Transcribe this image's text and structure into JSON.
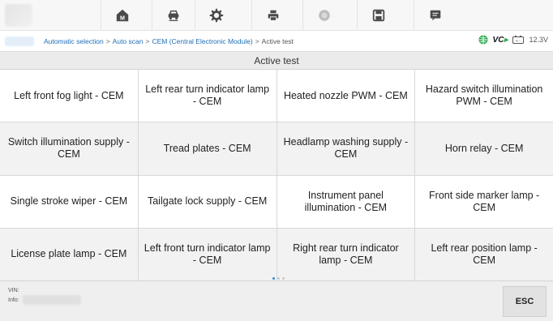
{
  "toolbar": {
    "buttons": [
      {
        "name": "home-icon"
      },
      {
        "name": "vehicle-swap-icon"
      },
      {
        "name": "settings-icon"
      },
      {
        "name": "print-icon"
      },
      {
        "name": "help-icon"
      },
      {
        "name": "save-icon"
      },
      {
        "name": "datalogging-icon"
      }
    ],
    "home_label": "M"
  },
  "breadcrumb": {
    "items": [
      "Automatic selection",
      "Auto scan",
      "CEM (Central Electronic Module)",
      "Active test"
    ],
    "separator": ">"
  },
  "status": {
    "vci_label": "VC",
    "battery_voltage": "12.3V"
  },
  "page_title": "Active test",
  "tests": [
    "Left front fog light - CEM",
    "Left rear turn indicator lamp - CEM",
    "Heated nozzle PWM - CEM",
    "Hazard switch illumination PWM - CEM",
    "Switch illumination supply - CEM",
    "Tread plates - CEM",
    "Headlamp washing supply - CEM",
    "Horn relay - CEM",
    "Single stroke wiper - CEM",
    "Tailgate lock supply - CEM",
    "Instrument panel illumination - CEM",
    "Front side marker lamp - CEM",
    "License plate lamp - CEM",
    "Left front turn indicator lamp - CEM",
    "Right rear turn indicator lamp - CEM",
    "Left rear position lamp - CEM"
  ],
  "footer": {
    "vin_label": "VIN:",
    "info_label": "Info:",
    "esc_label": "ESC"
  },
  "colors": {
    "breadcrumb_link": "#1f6fb8",
    "pager_active": "#2d8ee0",
    "vci_green": "#2aa84a"
  }
}
